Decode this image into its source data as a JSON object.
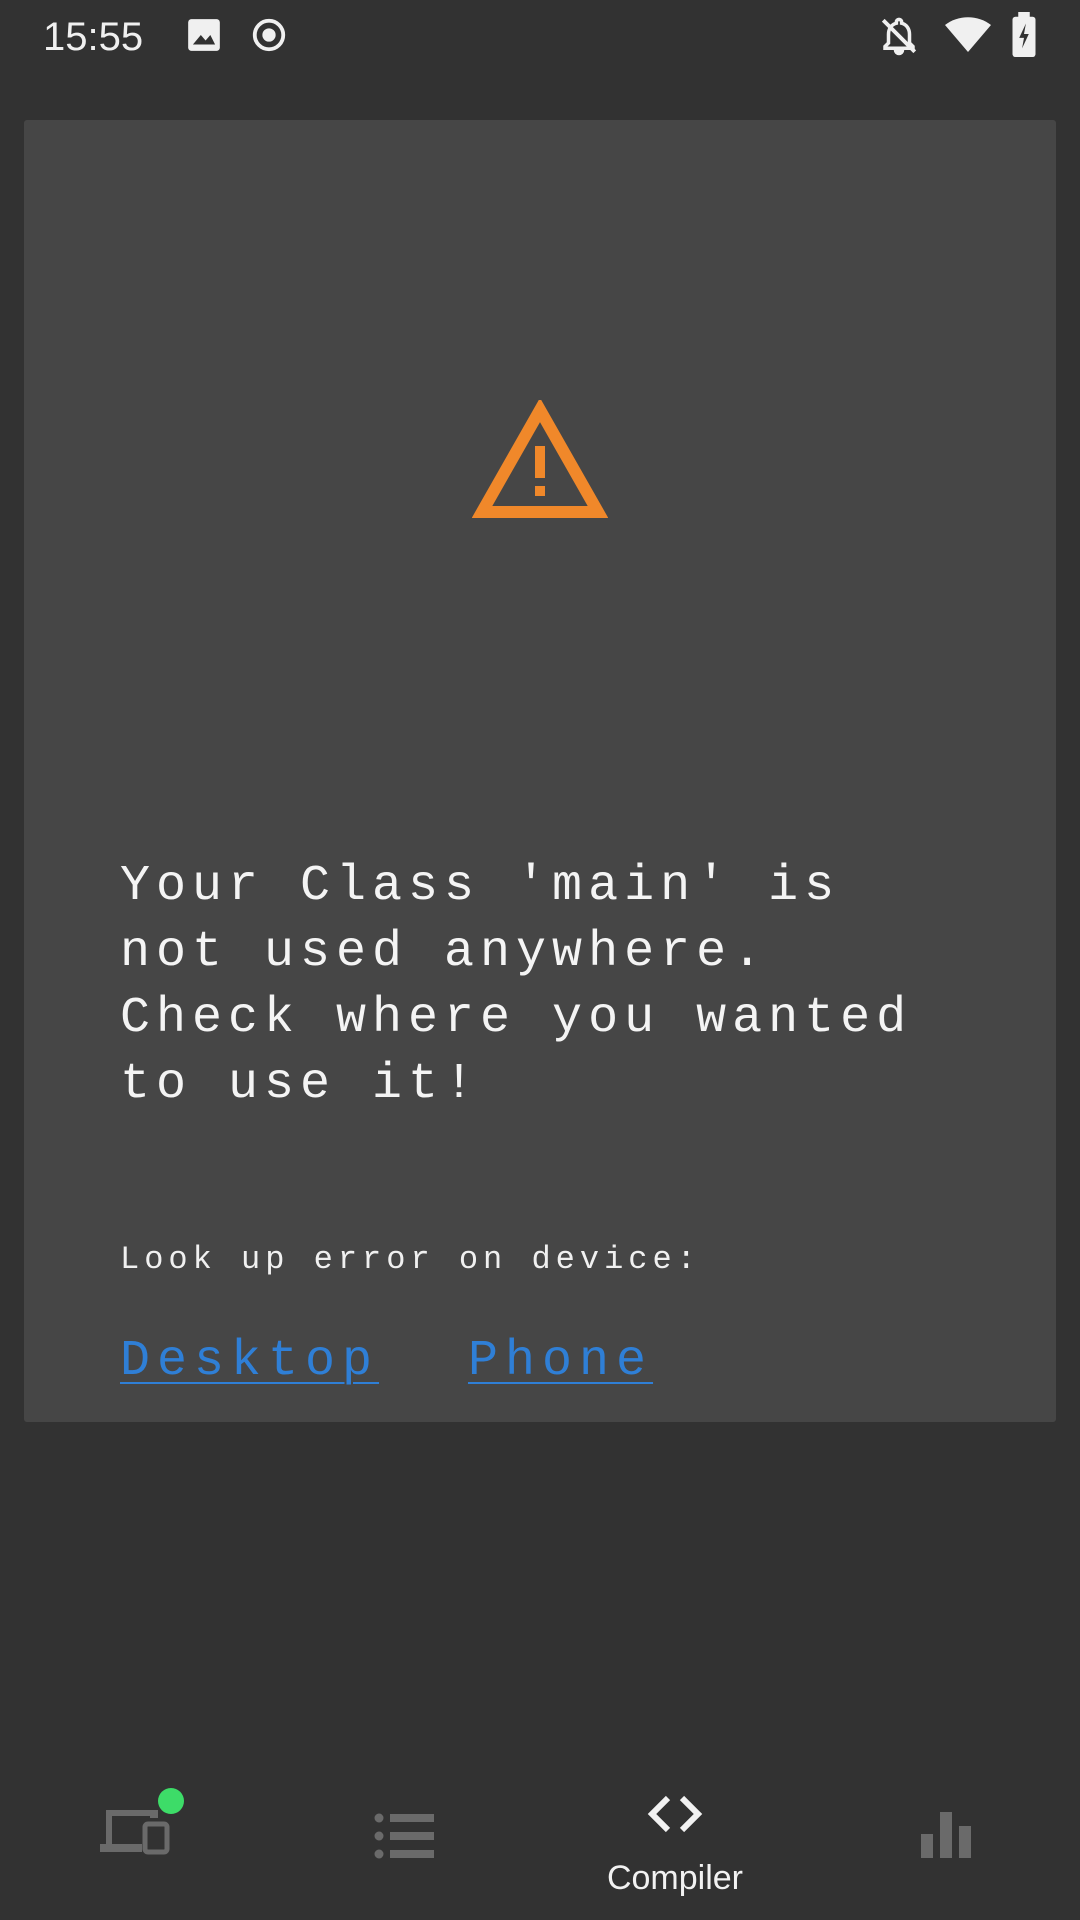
{
  "status_bar": {
    "time": "15:55",
    "icons": [
      "image-icon",
      "record-icon",
      "notifications-off-icon",
      "wifi-icon",
      "battery-charging-icon"
    ]
  },
  "error_card": {
    "icon": "warning-icon",
    "message": "Your Class 'main' is\nnot used anywhere.\nCheck where you wanted\nto use it!",
    "lookup_label": "Look up error on device:",
    "links": {
      "desktop": "Desktop",
      "phone": "Phone"
    }
  },
  "bottom_nav": {
    "items": [
      {
        "icon": "devices-icon",
        "label": "",
        "active": false,
        "badge_color": "#3ddc68"
      },
      {
        "icon": "list-icon",
        "label": "",
        "active": false
      },
      {
        "icon": "code-icon",
        "label": "Compiler",
        "active": true
      },
      {
        "icon": "bar-chart-icon",
        "label": "",
        "active": false
      }
    ]
  },
  "colors": {
    "background": "#323232",
    "card": "#464646",
    "warning": "#f0882a",
    "link": "#2f7fd6",
    "inactive_icon": "#6a6a6a"
  }
}
